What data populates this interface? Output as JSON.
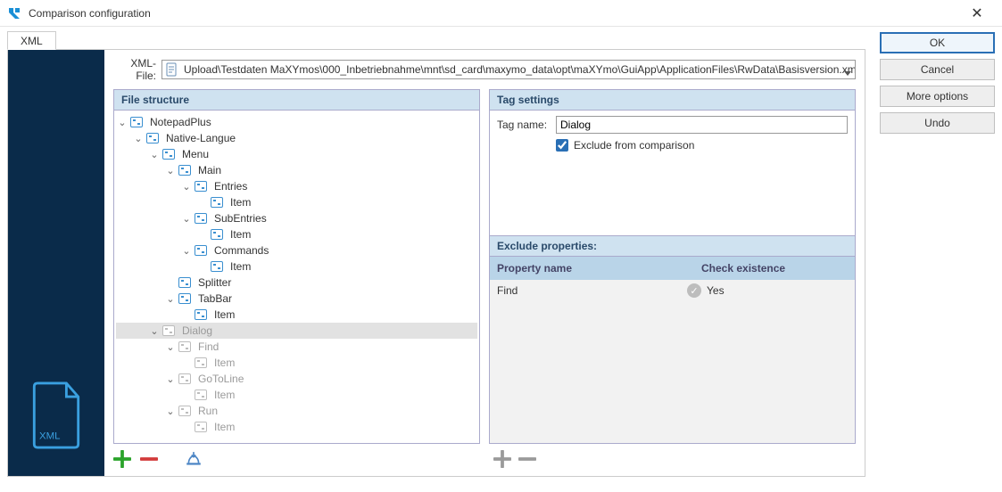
{
  "window": {
    "title": "Comparison configuration"
  },
  "tabs": [
    {
      "label": "XML"
    }
  ],
  "xml_file": {
    "label": "XML-File:",
    "path": "Upload\\Testdaten MaXYmos\\000_Inbetriebnahme\\mnt\\sd_card\\maxymo_data\\opt\\maXYmo\\GuiApp\\ApplicationFiles\\RwData\\Basisversion.xml"
  },
  "panels": {
    "file_structure": {
      "title": "File structure"
    },
    "tag_settings": {
      "title": "Tag settings"
    },
    "exclude_props": {
      "title": "Exclude properties:"
    }
  },
  "tree": [
    {
      "indent": 0,
      "exp": "open",
      "label": "NotepadPlus"
    },
    {
      "indent": 1,
      "exp": "open",
      "label": "Native-Langue"
    },
    {
      "indent": 2,
      "exp": "open",
      "label": "Menu"
    },
    {
      "indent": 3,
      "exp": "open",
      "label": "Main"
    },
    {
      "indent": 4,
      "exp": "open",
      "label": "Entries"
    },
    {
      "indent": 5,
      "exp": "none",
      "label": "Item"
    },
    {
      "indent": 4,
      "exp": "open",
      "label": "SubEntries"
    },
    {
      "indent": 5,
      "exp": "none",
      "label": "Item"
    },
    {
      "indent": 4,
      "exp": "open",
      "label": "Commands"
    },
    {
      "indent": 5,
      "exp": "none",
      "label": "Item"
    },
    {
      "indent": 3,
      "exp": "none",
      "label": "Splitter"
    },
    {
      "indent": 3,
      "exp": "open",
      "label": "TabBar"
    },
    {
      "indent": 4,
      "exp": "none",
      "label": "Item"
    },
    {
      "indent": 2,
      "exp": "open",
      "label": "Dialog",
      "dim": true,
      "selected": true
    },
    {
      "indent": 3,
      "exp": "open",
      "label": "Find",
      "dim": true
    },
    {
      "indent": 4,
      "exp": "none",
      "label": "Item",
      "dim": true
    },
    {
      "indent": 3,
      "exp": "open",
      "label": "GoToLine",
      "dim": true
    },
    {
      "indent": 4,
      "exp": "none",
      "label": "Item",
      "dim": true
    },
    {
      "indent": 3,
      "exp": "open",
      "label": "Run",
      "dim": true
    },
    {
      "indent": 4,
      "exp": "none",
      "label": "Item",
      "dim": true
    }
  ],
  "tag": {
    "name_label": "Tag name:",
    "name_value": "Dialog",
    "exclude_label": "Exclude from comparison",
    "exclude_checked": true
  },
  "grid": {
    "col1": "Property name",
    "col2": "Check existence",
    "rows": [
      {
        "name": "Find",
        "check": "Yes"
      }
    ]
  },
  "buttons": {
    "ok": "OK",
    "cancel": "Cancel",
    "more": "More options",
    "undo": "Undo"
  }
}
